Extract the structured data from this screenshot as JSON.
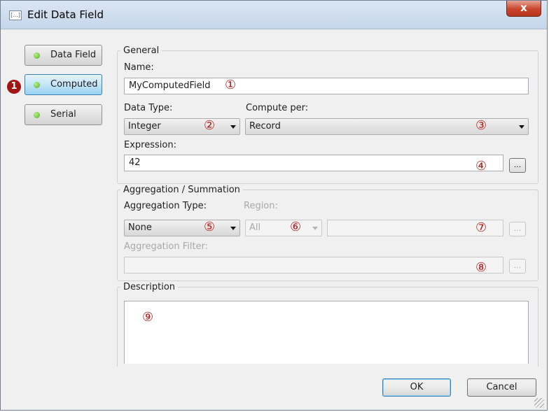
{
  "window": {
    "title": "Edit Data Field",
    "close_label": "x",
    "icon_label": "[...]"
  },
  "sidebar": {
    "badge": "1",
    "items": [
      {
        "label": "Data Field"
      },
      {
        "label": "Computed"
      },
      {
        "label": "Serial"
      }
    ]
  },
  "general": {
    "legend": "General",
    "name_label": "Name:",
    "name_value": "MyComputedField",
    "data_type_label": "Data Type:",
    "data_type_value": "Integer",
    "compute_per_label": "Compute per:",
    "compute_per_value": "Record",
    "expression_label": "Expression:",
    "expression_value": "42",
    "ellipsis": "..."
  },
  "aggregation": {
    "legend": "Aggregation / Summation",
    "type_label": "Aggregation Type:",
    "type_value": "None",
    "region_label": "Region:",
    "region_value": "All",
    "region_text": "",
    "filter_label": "Aggregation Filter:",
    "filter_value": "",
    "ellipsis": "..."
  },
  "description": {
    "legend": "Description",
    "value": ""
  },
  "callouts": [
    "①",
    "②",
    "③",
    "④",
    "⑤",
    "⑥",
    "⑦",
    "⑧",
    "⑨"
  ],
  "buttons": {
    "ok": "OK",
    "cancel": "Cancel"
  },
  "colors": {
    "callout": "#b41b1b",
    "active_button": "#98d1ef",
    "badge": "#a31515"
  }
}
